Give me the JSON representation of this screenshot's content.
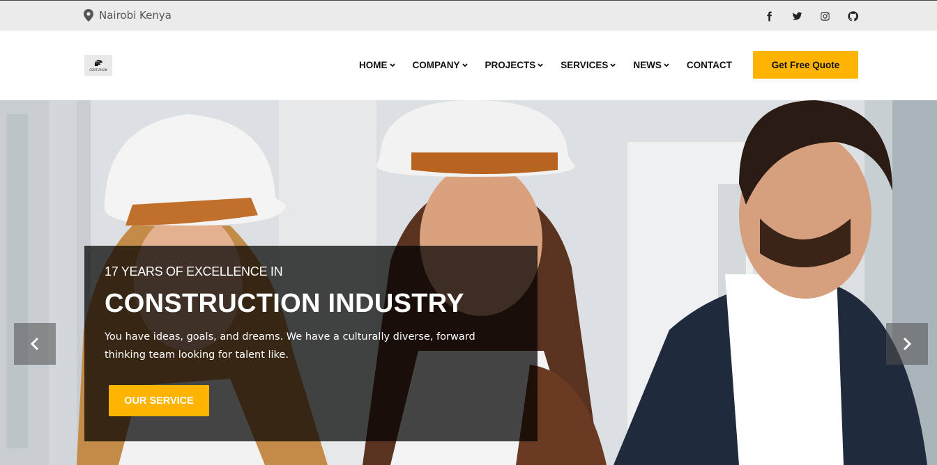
{
  "topbar": {
    "location": "Nairobi Kenya",
    "social": [
      "facebook-icon",
      "twitter-icon",
      "instagram-icon",
      "github-icon"
    ]
  },
  "header": {
    "logo_text": "CENTURION",
    "nav": [
      {
        "label": "HOME",
        "dropdown": true
      },
      {
        "label": "COMPANY",
        "dropdown": true
      },
      {
        "label": "PROJECTS",
        "dropdown": true
      },
      {
        "label": "SERVICES",
        "dropdown": true
      },
      {
        "label": "NEWS",
        "dropdown": true
      },
      {
        "label": "CONTACT",
        "dropdown": false
      }
    ],
    "cta_label": "Get Free Quote"
  },
  "hero": {
    "kicker": "17 YEARS OF EXCELLENCE IN",
    "headline": "CONSTRUCTION INDUSTRY",
    "description": "You have ideas, goals, and dreams. We have a culturally diverse, forward thinking team looking for talent like.",
    "button_label": "OUR SERVICE"
  },
  "colors": {
    "accent": "#ffb400",
    "topbar_bg": "#ebebeb",
    "caption_bg": "rgba(0,0,0,0.72)"
  }
}
